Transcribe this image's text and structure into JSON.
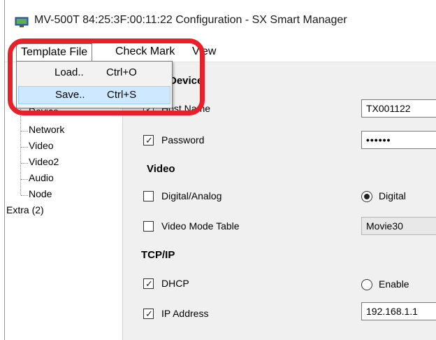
{
  "window": {
    "title": "MV-500T 84:25:3F:00:11:22  Configuration - SX Smart Manager"
  },
  "menubar": {
    "items": [
      "Template File",
      "Check Mark",
      "View"
    ]
  },
  "dropdown": {
    "items": [
      {
        "label": "Load..",
        "shortcut": "Ctrl+O"
      },
      {
        "label": "Save..",
        "shortcut": "Ctrl+S"
      }
    ]
  },
  "tree": {
    "items": [
      "Device",
      "Network",
      "Video",
      "Video2",
      "Audio",
      "Node"
    ],
    "extra": "Extra (2)"
  },
  "panel": {
    "device_section": "Device",
    "host_name_label": "Host Name",
    "host_name_value": "TX001122",
    "password_label": "Password",
    "password_value": "••••••",
    "video_section": "Video",
    "digital_analog_label": "Digital/Analog",
    "digital_option": "Digital",
    "video_mode_label": "Video Mode Table",
    "video_mode_value": "Movie30",
    "tcpip_section": "TCP/IP",
    "dhcp_label": "DHCP",
    "enable_option": "Enable",
    "ip_label": "IP Address",
    "ip_value": "192.168.1.1"
  },
  "colors": {
    "highlight": "#e8202a",
    "menu_hover": "#cde8ff"
  }
}
